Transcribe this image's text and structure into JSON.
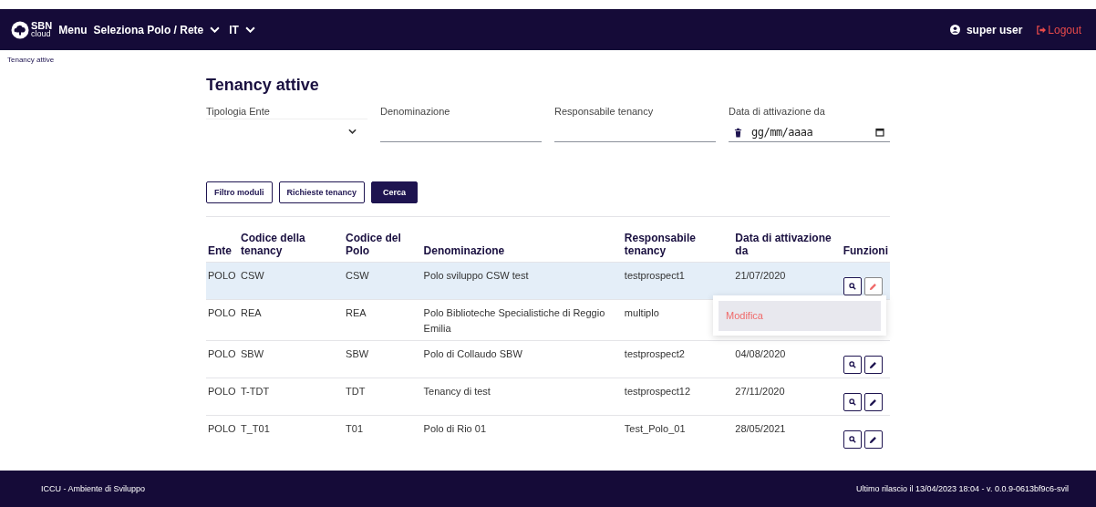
{
  "header": {
    "logo_top": "SBN",
    "logo_bottom": "cloud",
    "menu": "Menu",
    "polo_select": "Seleziona Polo / Rete",
    "language": "IT",
    "user": "super user",
    "logout": "Logout"
  },
  "breadcrumb": "Tenancy attive",
  "title": "Tenancy attive",
  "filters": [
    {
      "kind": "select",
      "label": "Tipologia Ente"
    },
    {
      "kind": "text",
      "label": "Denominazione"
    },
    {
      "kind": "text",
      "label": "Responsabile tenancy"
    },
    {
      "kind": "date",
      "label": "Data di attivazione da",
      "placeholder": "gg/mm/aaaa"
    }
  ],
  "buttons": [
    {
      "label": "Filtro moduli",
      "primary": false
    },
    {
      "label": "Richieste tenancy",
      "primary": false
    },
    {
      "label": "Cerca",
      "primary": true
    }
  ],
  "table": {
    "columns": [
      "Ente",
      "Codice della tenancy",
      "Codice del Polo",
      "Denominazione",
      "Responsabile tenancy",
      "Data di attivazione da",
      "Funzioni"
    ],
    "rows": [
      {
        "ente": "POLO",
        "codice": "CSW",
        "polo": "CSW",
        "denominazione": "Polo sviluppo CSW test",
        "responsabile": "testprospect1",
        "data": "21/07/2020",
        "selected": true,
        "edit_hover": true,
        "tooltip": "Modifica"
      },
      {
        "ente": "POLO",
        "codice": "REA",
        "polo": "REA",
        "denominazione": "Polo Biblioteche Specialistiche di Reggio Emilia",
        "responsabile": "multiplo",
        "selected": false
      },
      {
        "ente": "POLO",
        "codice": "SBW",
        "polo": "SBW",
        "denominazione": "Polo di Collaudo SBW",
        "responsabile": "testprospect2",
        "data": "04/08/2020",
        "selected": false,
        "edit_hover": false
      },
      {
        "ente": "POLO",
        "codice": "T-TDT",
        "polo": "TDT",
        "denominazione": "Tenancy di test",
        "responsabile": "testprospect12",
        "data": "27/11/2020",
        "selected": false,
        "edit_hover": false
      },
      {
        "ente": "POLO",
        "codice": "T_T01",
        "polo": "T01",
        "denominazione": "Polo di Rio 01",
        "responsabile": "Test_Polo_01",
        "data": "28/05/2021",
        "selected": false,
        "edit_hover": false
      }
    ]
  },
  "footer": {
    "left": "ICCU - Ambiente di Sviluppo",
    "right": "Ultimo rilascio il 13/04/2023 18:04 - v. 0.0.9-0613bf9c6-svil"
  }
}
